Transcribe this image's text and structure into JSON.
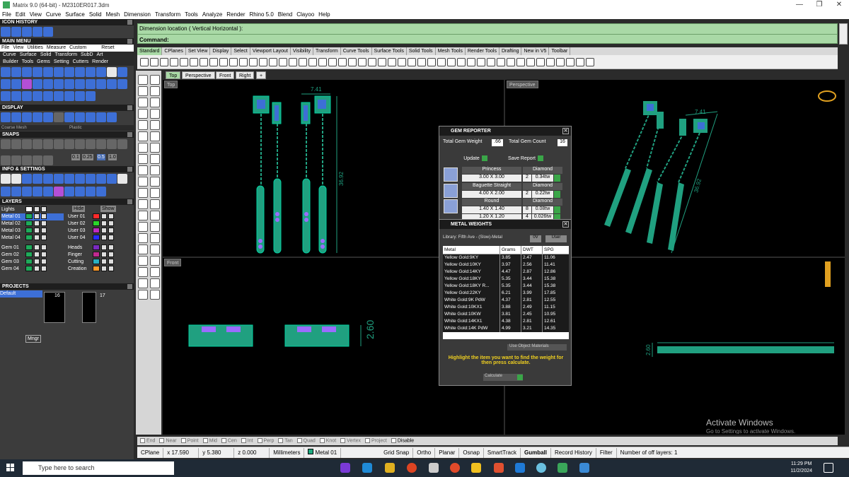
{
  "window": {
    "title": "Matrix 9.0 (64-bit) - M2310ER017.3dm",
    "controls": [
      "—",
      "❐",
      "✕"
    ]
  },
  "menubar": [
    "File",
    "Edit",
    "View",
    "Curve",
    "Surface",
    "Solid",
    "Mesh",
    "Dimension",
    "Transform",
    "Tools",
    "Analyze",
    "Render",
    "Rhino 5.0",
    "Blend",
    "Clayoo",
    "Help"
  ],
  "left": {
    "icon_history": "ICON HISTORY",
    "main_menu": "MAIN MENU",
    "main_menu_items": [
      "File",
      "View",
      "Utilities",
      "Measure",
      "Custom",
      "Reset"
    ],
    "main_menu_row2": [
      "Curve",
      "Surface",
      "Solid",
      "Transform",
      "SubD",
      "Art"
    ],
    "main_menu_row3": [
      "Builder",
      "Tools",
      "Gems",
      "Setting",
      "Cutters",
      "Render"
    ],
    "display": "DISPLAY",
    "display_modes": [
      "Coarse Mesh",
      "Plastic"
    ],
    "snaps": "SNAPS",
    "snap_values": [
      "0.1",
      "0.25",
      "0.5",
      "1.0"
    ],
    "info_settings": "INFO & SETTINGS",
    "layers": "LAYERS",
    "layers_hide": "Hide",
    "layers_show": "Show",
    "layer_left": [
      {
        "name": "Lights",
        "color": "#ffffff"
      },
      {
        "name": "Metal 01",
        "color": "#1faa5a",
        "selected": true
      },
      {
        "name": "Metal 02",
        "color": "#1faa5a"
      },
      {
        "name": "Metal 03",
        "color": "#1faa5a"
      },
      {
        "name": "Metal 04",
        "color": "#1faa5a"
      },
      {
        "name": "Gem 01",
        "color": "#1faa5a"
      },
      {
        "name": "Gem 02",
        "color": "#1faa5a"
      },
      {
        "name": "Gem 03",
        "color": "#1faa5a"
      },
      {
        "name": "Gem 04",
        "color": "#1faa5a"
      }
    ],
    "layer_right": [
      {
        "name": "User 01",
        "color": "#ff2a2a"
      },
      {
        "name": "User 02",
        "color": "#2ad62a"
      },
      {
        "name": "User 03",
        "color": "#c02ac0"
      },
      {
        "name": "User 04",
        "color": "#2a2aff"
      },
      {
        "name": "Heads",
        "color": "#7a2ac0"
      },
      {
        "name": "Finger",
        "color": "#c02a90"
      },
      {
        "name": "Cutting",
        "color": "#2ab0c0"
      },
      {
        "name": "Creation",
        "color": "#ff9a2a"
      }
    ],
    "projects": "PROJECTS",
    "project_default": "Default",
    "project_numbers": [
      "16",
      "17"
    ],
    "project_mngr": "Mngr"
  },
  "command": {
    "line1": "Dimension location ( Vertical  Horizontal ):",
    "line2": "Command:"
  },
  "tabs": [
    "Standard",
    "CPlanes",
    "Set View",
    "Display",
    "Select",
    "Viewport Layout",
    "Visibility",
    "Transform",
    "Curve Tools",
    "Surface Tools",
    "Solid Tools",
    "Mesh Tools",
    "Render Tools",
    "Drafting",
    "New in V5",
    "Toolbar"
  ],
  "viewport_tabs": [
    "Top",
    "Perspective",
    "Front",
    "Right",
    "+"
  ],
  "viewports": {
    "top": "Top",
    "perspective": "Perspective",
    "front": "Front"
  },
  "dims": {
    "top_width": "7.41",
    "top_height": "36.92",
    "front_height": "2.60",
    "persp_w": "7.41",
    "persp_h": "36.92",
    "right_h": "2.60"
  },
  "gem_reporter": {
    "title": "GEM REPORTER",
    "total_weight_label": "Total Gem Weight",
    "total_weight": ".66",
    "total_count_label": "Total Gem Count",
    "total_count": "16",
    "update": "Update",
    "save_report": "Save Report",
    "rows": [
      {
        "shape": "Princess",
        "dims": "3.00 X 3.00",
        "type": "Diamond",
        "count": "2",
        "weight": "0.34tw"
      },
      {
        "shape": "Baguette Straight",
        "dims": "4.00 X 2.00",
        "type": "Diamond",
        "count": "2",
        "weight": "0.22tw"
      },
      {
        "shape": "Round",
        "dims": "1.40 X 1.40",
        "type": "Diamond",
        "count": "8",
        "weight": "0.08tw"
      },
      {
        "shape": "",
        "dims": "1.20 X 1.20",
        "type": "",
        "count": "4",
        "weight": "0.026tw"
      }
    ]
  },
  "metal_weights": {
    "title": "METAL WEIGHTS",
    "library": "Library: Fifth Ave - (Slow)-Metal",
    "btn_a": "0V",
    "btn_b": "User",
    "headers": [
      "Metal",
      "Grams",
      "DWT",
      "SPG"
    ],
    "rows": [
      [
        "Yellow Gold:9KY",
        "3.85",
        "2.47",
        "11.06"
      ],
      [
        "Yellow Gold:10KY",
        "3.97",
        "2.56",
        "11.41"
      ],
      [
        "Yellow Gold:14KY",
        "4.47",
        "2.87",
        "12.86"
      ],
      [
        "Yellow Gold:18KY",
        "5.35",
        "3.44",
        "15.38"
      ],
      [
        "Yellow Gold:18KY R...",
        "5.35",
        "3.44",
        "15.38"
      ],
      [
        "Yellow Gold:22KY",
        "6.21",
        "3.99",
        "17.85"
      ],
      [
        "White Gold:9K PdW",
        "4.37",
        "2.81",
        "12.55"
      ],
      [
        "White Gold:10KX1",
        "3.88",
        "2.49",
        "11.15"
      ],
      [
        "White Gold:10KW",
        "3.81",
        "2.45",
        "10.95"
      ],
      [
        "White Gold:14KX1",
        "4.38",
        "2.81",
        "12.61"
      ],
      [
        "White Gold:14K PdW",
        "4.99",
        "3.21",
        "14.35"
      ]
    ],
    "use_obj": "Use Object Materials",
    "hint": "Highlight the item you want to find the weight for then press calculate.",
    "calculate": "Calculate"
  },
  "osnap": [
    "End",
    "Near",
    "Point",
    "Mid",
    "Cen",
    "Int",
    "Perp",
    "Tan",
    "Quad",
    "Knot",
    "Vertex",
    "Project",
    "Disable"
  ],
  "status": {
    "cplane": "CPlane",
    "x": "x 17.590",
    "y": "y 5.380",
    "z": "z 0.000",
    "units": "Millimeters",
    "layer": "Metal 01",
    "grid": "Grid Snap",
    "ortho": "Ortho",
    "planar": "Planar",
    "osnap": "Osnap",
    "smarttrack": "SmartTrack",
    "gumball": "Gumball",
    "record": "Record History",
    "filter": "Filter",
    "layers_off": "Number of off layers: 1"
  },
  "taskbar": {
    "search": "Type here to search",
    "time": "11:29 PM",
    "date": "11/2/2024"
  },
  "watermark": {
    "line1": "Activate Windows",
    "line2": "Go to Settings to activate Windows."
  },
  "colors": {
    "accent_green": "#a9d9a6",
    "metal": "#1faa80",
    "gem": "#9a6cff"
  }
}
